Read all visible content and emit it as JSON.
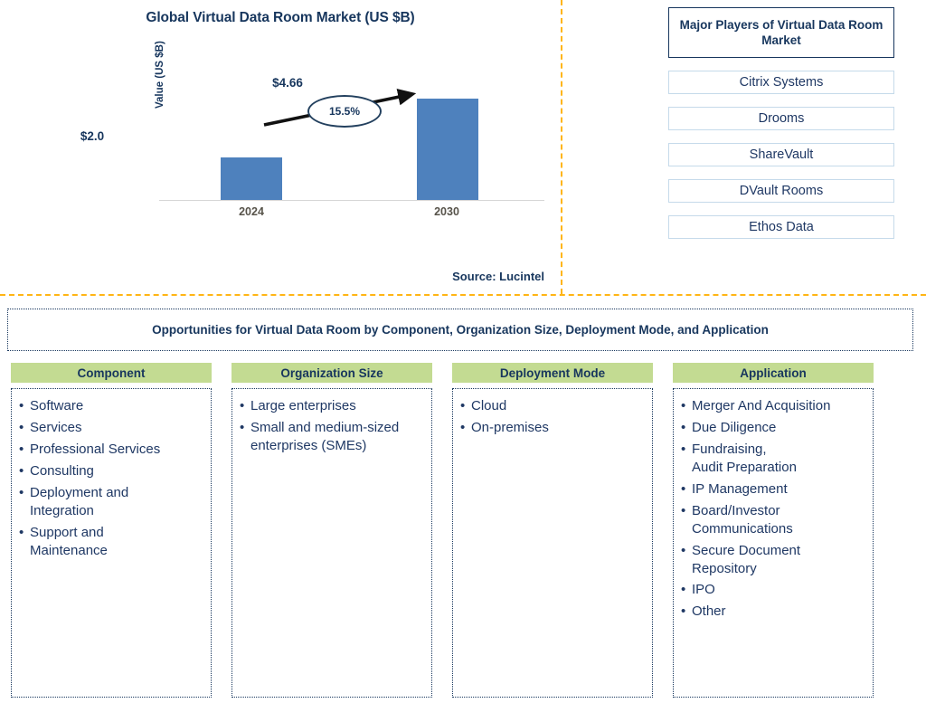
{
  "chart_panel": {
    "title": "Global Virtual Data Room Market (US $B)",
    "ylabel": "Value (US $B)",
    "cagr_label": "15.5%",
    "value_2024": "$2.0",
    "value_2030": "$4.66",
    "tick_2024": "2024",
    "tick_2030": "2030",
    "source": "Source: Lucintel",
    "bar_color": "#4E81BD",
    "divider_color": "#FFB515"
  },
  "chart_data": {
    "type": "bar",
    "title": "Global Virtual Data Room Market (US $B)",
    "categories": [
      "2024",
      "2030"
    ],
    "values": [
      2.0,
      4.66
    ],
    "value_labels": [
      "$2.0",
      "$4.66"
    ],
    "xlabel": "",
    "ylabel": "Value (US $B)",
    "ylim": [
      0,
      5.2
    ],
    "grid": false,
    "legend": "none",
    "annotations": [
      {
        "text": "15.5%",
        "type": "cagr-bubble-with-arrow",
        "from": "2024",
        "to": "2030"
      }
    ],
    "source": "Source: Lucintel",
    "series_color": "#4E81BD"
  },
  "players": {
    "header": "Major Players of Virtual Data Room Market",
    "items": [
      "Citrix Systems",
      "Drooms",
      "ShareVault",
      "DVault Rooms",
      "Ethos Data"
    ]
  },
  "opportunities": {
    "banner": "Opportunities for Virtual Data Room by Component, Organization Size, Deployment Mode, and Application",
    "header_color": "#C3DB92",
    "columns": [
      {
        "header": "Component",
        "items": [
          "Software",
          "Services",
          "Professional Services",
          "Consulting",
          "Deployment and\nIntegration",
          "Support and\nMaintenance"
        ]
      },
      {
        "header": "Organization Size",
        "items": [
          "Large enterprises",
          "Small and medium-sized\nenterprises (SMEs)"
        ]
      },
      {
        "header": "Deployment Mode",
        "items": [
          "Cloud",
          "On-premises"
        ]
      },
      {
        "header": "Application",
        "items": [
          "Merger And Acquisition",
          "Due Diligence",
          "Fundraising,\nAudit Preparation",
          "IP Management",
          "Board/Investor\nCommunications",
          "Secure Document\nRepository",
          "IPO",
          "Other"
        ]
      }
    ]
  }
}
